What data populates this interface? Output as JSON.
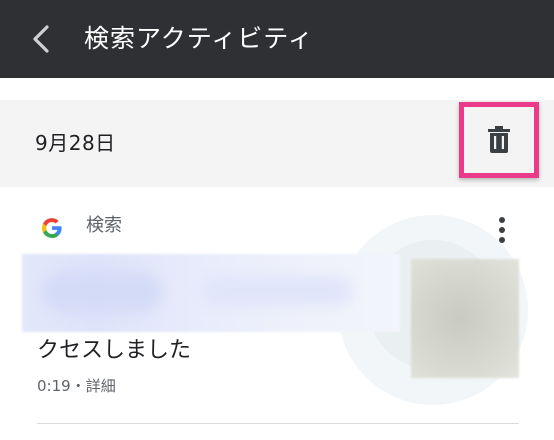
{
  "appbar": {
    "title": "検索アクティビティ",
    "background": "#2f3033"
  },
  "date_group": {
    "date": "9月28日",
    "highlight_color": "#ec3a8a"
  },
  "activity": {
    "source_label": "検索",
    "title": "クセスしました",
    "time": "0:19",
    "separator": "・",
    "details_link": "詳細"
  },
  "icons": {
    "back": "chevron-left-icon",
    "delete": "trash-icon",
    "google": "google-g-icon",
    "more": "more-vert-icon"
  }
}
